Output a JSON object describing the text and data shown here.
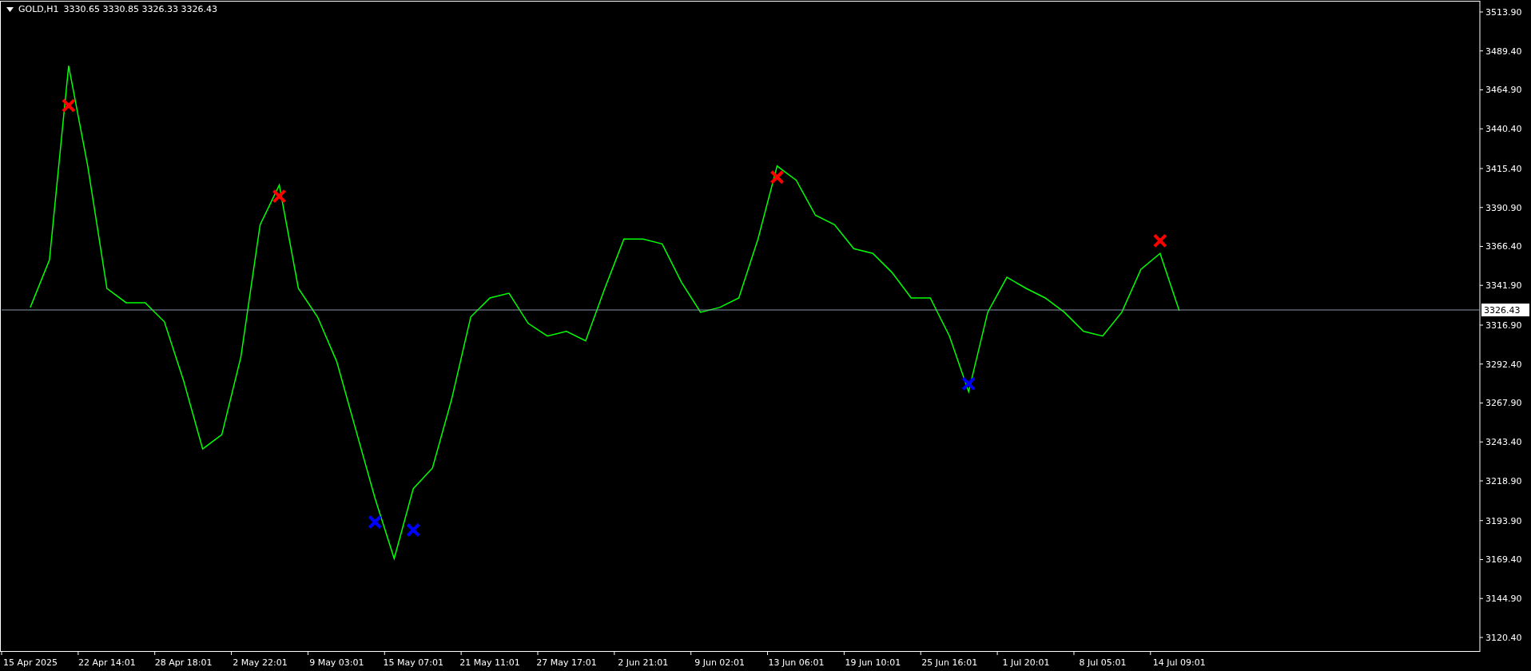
{
  "header": {
    "symbol": "GOLD,H1",
    "quotes": "3330.65 3330.85 3326.33 3326.43"
  },
  "chart_data": {
    "type": "line",
    "ylim": [
      3111.35,
      3520.43
    ],
    "categories": [
      "15 Apr 2025",
      null,
      null,
      null,
      "22 Apr 14:01",
      null,
      null,
      null,
      "28 Apr 18:01",
      null,
      null,
      null,
      "2 May 22:01",
      null,
      null,
      null,
      "9 May 03:01",
      null,
      null,
      null,
      "15 May 07:01",
      null,
      null,
      null,
      "21 May 11:01",
      null,
      null,
      null,
      "27 May 17:01",
      null,
      null,
      null,
      "2 Jun 21:01",
      null,
      null,
      null,
      "9 Jun 02:01",
      null,
      null,
      null,
      "13 Jun 06:01",
      null,
      null,
      null,
      "19 Jun 10:01",
      null,
      null,
      null,
      "25 Jun 16:01",
      null,
      null,
      null,
      "1 Jul 20:01",
      null,
      null,
      null,
      "8 Jul 05:01",
      null,
      null,
      null,
      "14 Jul 09:01"
    ],
    "yticks": [
      {
        "value": 3513.9,
        "label": "3513.90"
      },
      {
        "value": 3489.4,
        "label": "3489.40"
      },
      {
        "value": 3464.9,
        "label": "3464.90"
      },
      {
        "value": 3440.4,
        "label": "3440.40"
      },
      {
        "value": 3415.4,
        "label": "3415.40"
      },
      {
        "value": 3390.9,
        "label": "3390.90"
      },
      {
        "value": 3366.4,
        "label": "3366.40"
      },
      {
        "value": 3341.9,
        "label": "3341.90"
      },
      {
        "value": 3316.9,
        "label": "3316.90"
      },
      {
        "value": 3292.4,
        "label": "3292.40"
      },
      {
        "value": 3267.9,
        "label": "3267.90"
      },
      {
        "value": 3243.4,
        "label": "3243.40"
      },
      {
        "value": 3218.9,
        "label": "3218.90"
      },
      {
        "value": 3193.9,
        "label": "3193.90"
      },
      {
        "value": 3169.4,
        "label": "3169.40"
      },
      {
        "value": 3144.9,
        "label": "3144.90"
      },
      {
        "value": 3120.4,
        "label": "3120.40"
      }
    ],
    "series": [
      {
        "color": "#00ff00",
        "values": [
          3328,
          3358,
          3480,
          3417,
          3340,
          3331,
          3331,
          3319,
          3282,
          3239,
          3248,
          3297,
          3380,
          3405,
          3340,
          3322,
          3294,
          3251,
          3208,
          3170,
          3214,
          3227,
          3270,
          3322,
          3334,
          3337,
          3318,
          3310,
          3313,
          3307,
          3340,
          3371,
          3371,
          3368,
          3344,
          3325,
          3328,
          3334,
          3371,
          3417,
          3408,
          3386,
          3380,
          3365,
          3362,
          3350,
          3334,
          3334,
          3310,
          3275,
          3325,
          3347,
          3340,
          3334,
          3325,
          3313,
          3310,
          3325,
          3352,
          3362,
          3326
        ]
      },
      {
        "color": "#ff0000",
        "marker": "x",
        "values": [
          null,
          null,
          3455,
          null,
          null,
          null,
          null,
          null,
          null,
          null,
          null,
          null,
          null,
          3398,
          null,
          null,
          null,
          null,
          null,
          null,
          null,
          null,
          null,
          null,
          null,
          null,
          null,
          null,
          null,
          null,
          null,
          null,
          null,
          null,
          null,
          null,
          null,
          null,
          null,
          3410,
          null,
          null,
          null,
          null,
          null,
          null,
          null,
          null,
          null,
          null,
          null,
          null,
          null,
          null,
          null,
          null,
          null,
          null,
          null,
          3370,
          null
        ]
      },
      {
        "color": "#0000ff",
        "marker": "x",
        "values": [
          null,
          null,
          null,
          null,
          null,
          null,
          null,
          null,
          null,
          null,
          null,
          null,
          null,
          null,
          null,
          null,
          null,
          null,
          3193,
          null,
          3188,
          null,
          null,
          null,
          null,
          null,
          null,
          null,
          null,
          null,
          null,
          null,
          null,
          null,
          null,
          null,
          null,
          null,
          null,
          null,
          null,
          null,
          null,
          null,
          null,
          null,
          null,
          null,
          null,
          3280,
          null,
          null,
          null,
          null,
          null,
          null,
          null,
          null,
          null,
          null,
          null
        ]
      }
    ],
    "ref_lines": [
      {
        "axis": "y",
        "value": 3326.43,
        "label": "3326.43",
        "color": "#8899aa"
      }
    ]
  }
}
